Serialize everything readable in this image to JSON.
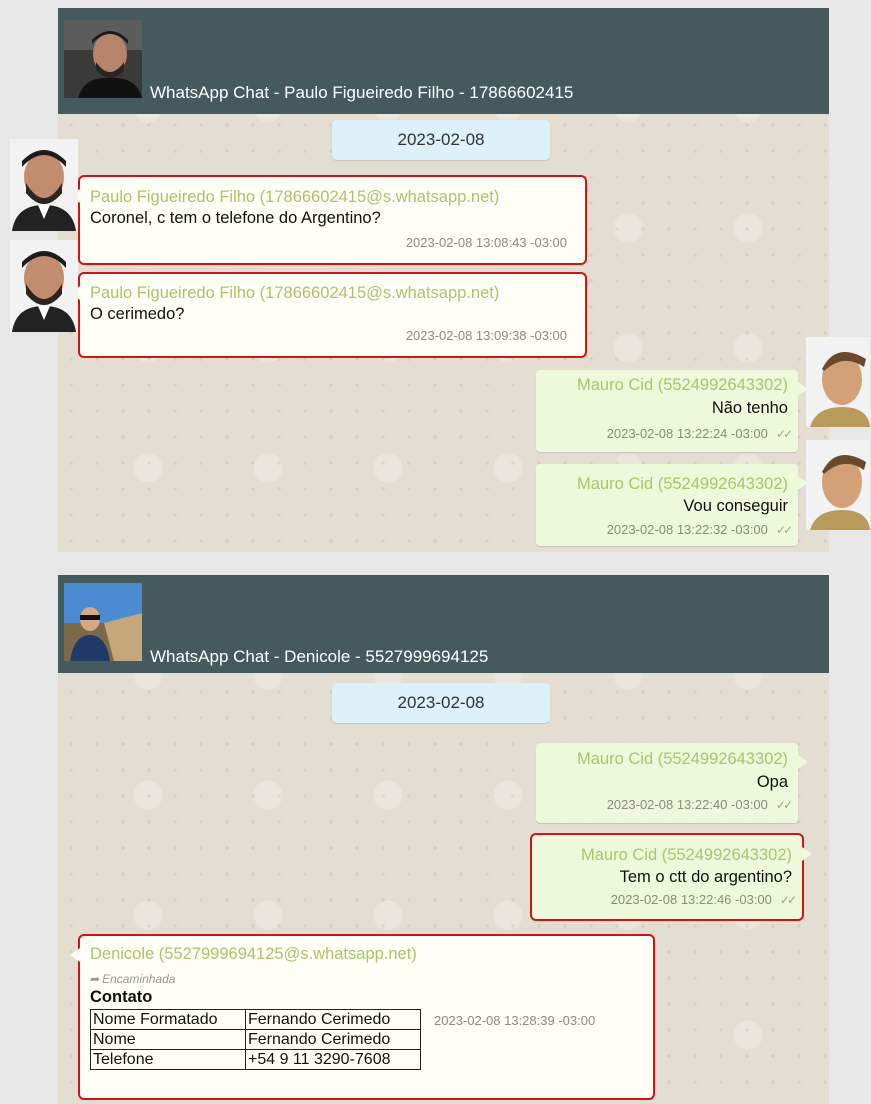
{
  "chat1": {
    "title": "WhatsApp Chat - Paulo Figueiredo Filho - 17866602415",
    "date": "2023-02-08",
    "messages": [
      {
        "sender": "Paulo Figueiredo Filho (17866602415@s.whatsapp.net)",
        "text": "Coronel, c tem o telefone do Argentino?",
        "time": "2023-02-08 13:08:43 -03:00"
      },
      {
        "sender": "Paulo Figueiredo Filho (17866602415@s.whatsapp.net)",
        "text": "O cerimedo?",
        "time": "2023-02-08 13:09:38 -03:00"
      },
      {
        "sender": "Mauro Cid (5524992643302)",
        "text": "Não tenho",
        "time": "2023-02-08 13:22:24 -03:00"
      },
      {
        "sender": "Mauro Cid (5524992643302)",
        "text": "Vou conseguir",
        "time": "2023-02-08 13:22:32 -03:00"
      }
    ]
  },
  "chat2": {
    "title": "WhatsApp Chat - Denicole - 5527999694125",
    "date": "2023-02-08",
    "messages": [
      {
        "sender": "Mauro Cid (5524992643302)",
        "text": "Opa",
        "time": "2023-02-08 13:22:40 -03:00"
      },
      {
        "sender": "Mauro Cid (5524992643302)",
        "text": "Tem o ctt do argentino?",
        "time": "2023-02-08 13:22:46 -03:00"
      }
    ],
    "contact_message": {
      "sender": "Denicole (5527999694125@s.whatsapp.net)",
      "forwarded": "Encaminhada",
      "contact_title": "Contato",
      "time": "2023-02-08 13:28:39 -03:00",
      "rows": [
        {
          "key": "Nome Formatado",
          "value": "Fernando Cerimedo"
        },
        {
          "key": "Nome",
          "value": "Fernando Cerimedo"
        },
        {
          "key": "Telefone",
          "value": "+54 9 11 3290-7608"
        }
      ]
    }
  },
  "icons": {
    "read_receipt": "double-check-icon",
    "forward": "forward-arrow-icon"
  },
  "colors": {
    "header": "#455a5c",
    "incoming_bubble": "#fffef6",
    "outgoing_bubble": "#eef8db",
    "sender_name": "#a9c46b",
    "highlight_border": "#cc1515",
    "date_chip": "#dcf1fa"
  }
}
